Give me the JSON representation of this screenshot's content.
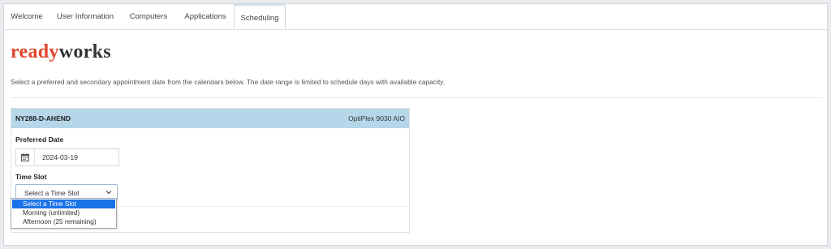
{
  "tabs": {
    "items": [
      {
        "label": "Welcome"
      },
      {
        "label": "User Information"
      },
      {
        "label": "Computers"
      },
      {
        "label": "Applications"
      },
      {
        "label": "Scheduling"
      }
    ],
    "active": "Scheduling"
  },
  "logo": {
    "part1": "ready",
    "part2": "works"
  },
  "instructions": "Select a preferred and secondary appointment date from the calendars below. The date range is limited to schedule days with available capacity.",
  "card": {
    "computer_name": "NY288-D-AHEND",
    "model": "OptiPlex 9030 AIO",
    "preferred_date_label": "Preferred Date",
    "preferred_date_value": "2024-03-19",
    "time_slot_label": "Time Slot",
    "time_slot_value": "Select a Time Slot"
  },
  "time_slot_options": [
    {
      "label": "Select a Time Slot",
      "selected": true
    },
    {
      "label": "Morning (unlimited)",
      "selected": false
    },
    {
      "label": "Afternoon (25 remaining)",
      "selected": false
    }
  ],
  "colors": {
    "brand_red": "#e0462b",
    "header_blue": "#b6d7ea",
    "selected_blue": "#1a73e8"
  },
  "icons": {
    "calendar": "calendar-icon",
    "chevron": "chevron-down-icon"
  }
}
